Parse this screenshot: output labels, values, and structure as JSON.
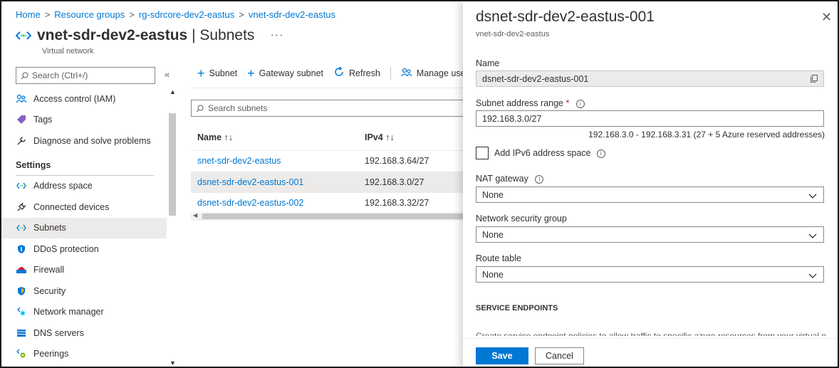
{
  "breadcrumb": [
    "Home",
    "Resource groups",
    "rg-sdrcore-dev2-eastus",
    "vnet-sdr-dev2-eastus"
  ],
  "header": {
    "title_bold": "vnet-sdr-dev2-eastus",
    "title_rest": " | Subnets",
    "more": "···",
    "subtitle": "Virtual network"
  },
  "sidebar": {
    "search_placeholder": "Search (Ctrl+/)",
    "collapse": "«",
    "items_top": [
      {
        "label": "Access control (IAM)",
        "icon": "people-icon"
      },
      {
        "label": "Tags",
        "icon": "tag-icon"
      },
      {
        "label": "Diagnose and solve problems",
        "icon": "wrench-icon"
      }
    ],
    "section": "Settings",
    "items": [
      {
        "label": "Address space",
        "icon": "vnet-icon"
      },
      {
        "label": "Connected devices",
        "icon": "plug-icon"
      },
      {
        "label": "Subnets",
        "icon": "vnet-icon",
        "active": true
      },
      {
        "label": "DDoS protection",
        "icon": "shield-icon"
      },
      {
        "label": "Firewall",
        "icon": "firewall-icon"
      },
      {
        "label": "Security",
        "icon": "security-icon"
      },
      {
        "label": "Network manager",
        "icon": "network-manager-icon"
      },
      {
        "label": "DNS servers",
        "icon": "dns-icon"
      },
      {
        "label": "Peerings",
        "icon": "peerings-icon"
      }
    ]
  },
  "toolbar": {
    "subnet": "Subnet",
    "gateway_subnet": "Gateway subnet",
    "refresh": "Refresh",
    "manage_users": "Manage use"
  },
  "subnets": {
    "search_placeholder": "Search subnets",
    "columns": [
      "Name ↑↓",
      "IPv4 ↑↓"
    ],
    "rows": [
      {
        "name": "snet-sdr-dev2-eastus",
        "ipv4": "192.168.3.64/27"
      },
      {
        "name": "dsnet-sdr-dev2-eastus-001",
        "ipv4": "192.168.3.0/27",
        "selected": true
      },
      {
        "name": "dsnet-sdr-dev2-eastus-002",
        "ipv4": "192.168.3.32/27"
      }
    ]
  },
  "panel": {
    "title": "dsnet-sdr-dev2-eastus-001",
    "subtitle": "vnet-sdr-dev2-eastus",
    "close": "✕",
    "name_label": "Name",
    "name_value": "dsnet-sdr-dev2-eastus-001",
    "range_label": "Subnet address range",
    "range_required": "*",
    "range_value": "192.168.3.0/27",
    "range_hint": "192.168.3.0 - 192.168.3.31 (27 + 5 Azure reserved addresses)",
    "ipv6_label": "Add IPv6 address space",
    "nat_label": "NAT gateway",
    "nat_value": "None",
    "nsg_label": "Network security group",
    "nsg_value": "None",
    "route_label": "Route table",
    "route_value": "None",
    "section_title": "SERVICE ENDPOINTS",
    "description": "Create service endpoint policies to allow traffic to specific azure resources from your virtual network",
    "save": "Save",
    "cancel": "Cancel"
  },
  "colors": {
    "accent": "#0078d4",
    "selected_row": "#edebe9",
    "required": "#a4262c"
  }
}
